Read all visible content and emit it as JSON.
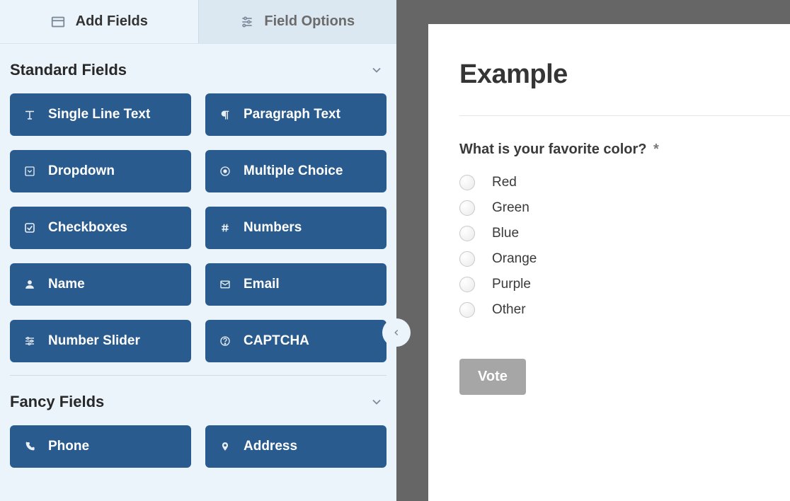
{
  "tabs": {
    "add_fields": "Add Fields",
    "field_options": "Field Options"
  },
  "sections": {
    "standard": "Standard Fields",
    "fancy": "Fancy Fields"
  },
  "fields": {
    "single_line_text": "Single Line Text",
    "paragraph_text": "Paragraph Text",
    "dropdown": "Dropdown",
    "multiple_choice": "Multiple Choice",
    "checkboxes": "Checkboxes",
    "numbers": "Numbers",
    "name": "Name",
    "email": "Email",
    "number_slider": "Number Slider",
    "captcha": "CAPTCHA",
    "phone": "Phone",
    "address": "Address"
  },
  "preview": {
    "title": "Example",
    "question": "What is your favorite color?",
    "required_mark": "*",
    "options": [
      "Red",
      "Green",
      "Blue",
      "Orange",
      "Purple",
      "Other"
    ],
    "submit_label": "Vote"
  }
}
